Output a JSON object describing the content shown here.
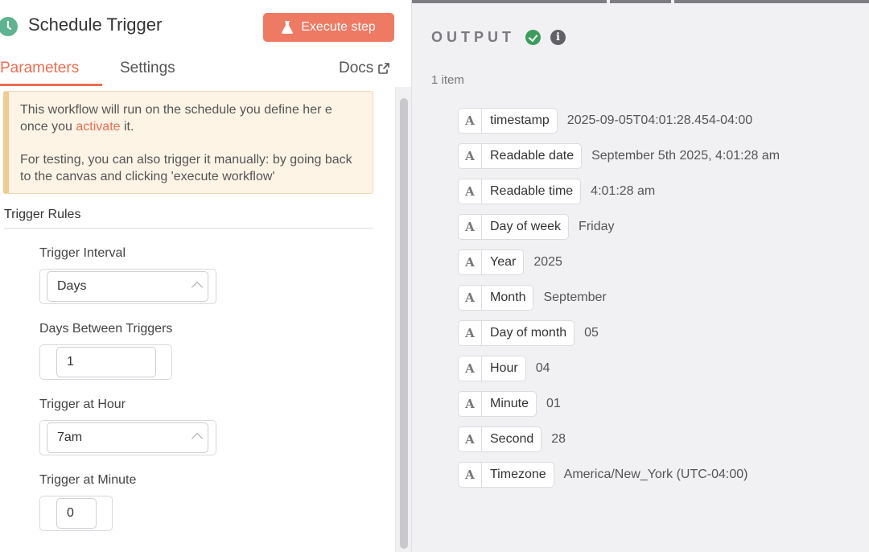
{
  "header": {
    "title": "Schedule Trigger",
    "execute_label": "Execute step"
  },
  "tabs": {
    "parameters": "Parameters",
    "settings": "Settings",
    "docs": "Docs"
  },
  "notice": {
    "line1_pre": "This workflow will run on the schedule you define her e once you ",
    "line1_link": "activate",
    "line1_post": " it.",
    "line2": "For testing, you can also trigger it manually: by going back to the canvas and clicking 'execute workflow'"
  },
  "trigger_rules": {
    "heading": "Trigger Rules",
    "interval_label": "Trigger Interval",
    "interval_value": "Days",
    "days_between_label": "Days Between Triggers",
    "days_between_value": "1",
    "hour_label": "Trigger at Hour",
    "hour_value": "7am",
    "minute_label": "Trigger at Minute",
    "minute_value": "0"
  },
  "output": {
    "title": "OUTPUT",
    "items_count": "1 item",
    "type_glyph": "A",
    "fields": [
      {
        "key": "timestamp",
        "value": "2025-09-05T04:01:28.454-04:00"
      },
      {
        "key": "Readable date",
        "value": "September 5th 2025, 4:01:28 am"
      },
      {
        "key": "Readable time",
        "value": "4:01:28 am"
      },
      {
        "key": "Day of week",
        "value": "Friday"
      },
      {
        "key": "Year",
        "value": "2025"
      },
      {
        "key": "Month",
        "value": "September"
      },
      {
        "key": "Day of month",
        "value": "05"
      },
      {
        "key": "Hour",
        "value": "04"
      },
      {
        "key": "Minute",
        "value": "01"
      },
      {
        "key": "Second",
        "value": "28"
      },
      {
        "key": "Timezone",
        "value": "America/New_York (UTC-04:00)"
      }
    ]
  },
  "colors": {
    "accent": "#ef6c50",
    "button": "#ee7a63",
    "success": "#3b9d5d",
    "trigger_icon": "#5fb38f"
  }
}
